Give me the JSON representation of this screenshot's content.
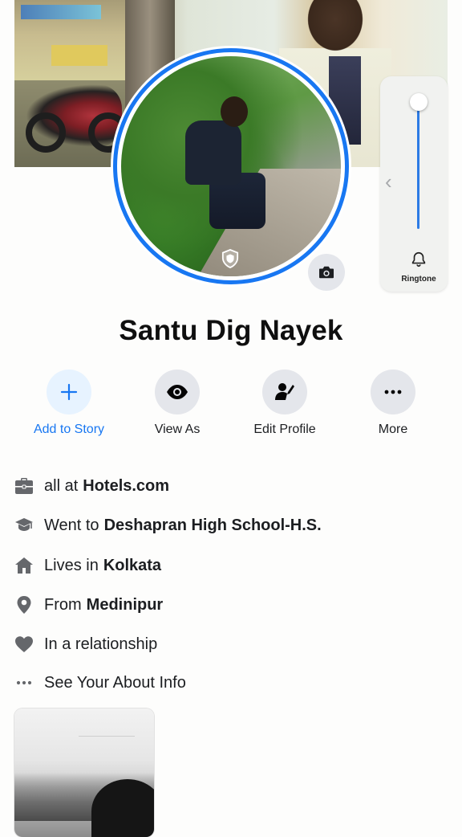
{
  "profile": {
    "name": "Santu Dig Nayek"
  },
  "volume_panel": {
    "label": "Ringtone",
    "level_fraction": 1.0
  },
  "actions": [
    {
      "label": "Add to Story",
      "icon": "plus-icon"
    },
    {
      "label": "View As",
      "icon": "eye-icon"
    },
    {
      "label": "Edit Profile",
      "icon": "edit-profile-icon"
    },
    {
      "label": "More",
      "icon": "ellipsis-icon"
    }
  ],
  "intro": {
    "work": {
      "prefix": "all at",
      "value": "Hotels.com",
      "icon": "briefcase-icon"
    },
    "education": {
      "prefix": "Went to",
      "value": "Deshapran High School-H.S.",
      "icon": "graduation-cap-icon"
    },
    "lives": {
      "prefix": "Lives in",
      "value": "Kolkata",
      "icon": "home-icon"
    },
    "from": {
      "prefix": "From",
      "value": "Medinipur",
      "icon": "location-pin-icon"
    },
    "relationship": {
      "text": "In a relationship",
      "icon": "heart-icon"
    },
    "about": {
      "text": "See Your About Info",
      "icon": "ellipsis-icon"
    }
  },
  "colors": {
    "accent": "#1877f2",
    "button_bg": "#e4e6eb",
    "primary_button_bg": "#e7f3ff",
    "text": "#1c1e21",
    "icon": "#65676b"
  }
}
